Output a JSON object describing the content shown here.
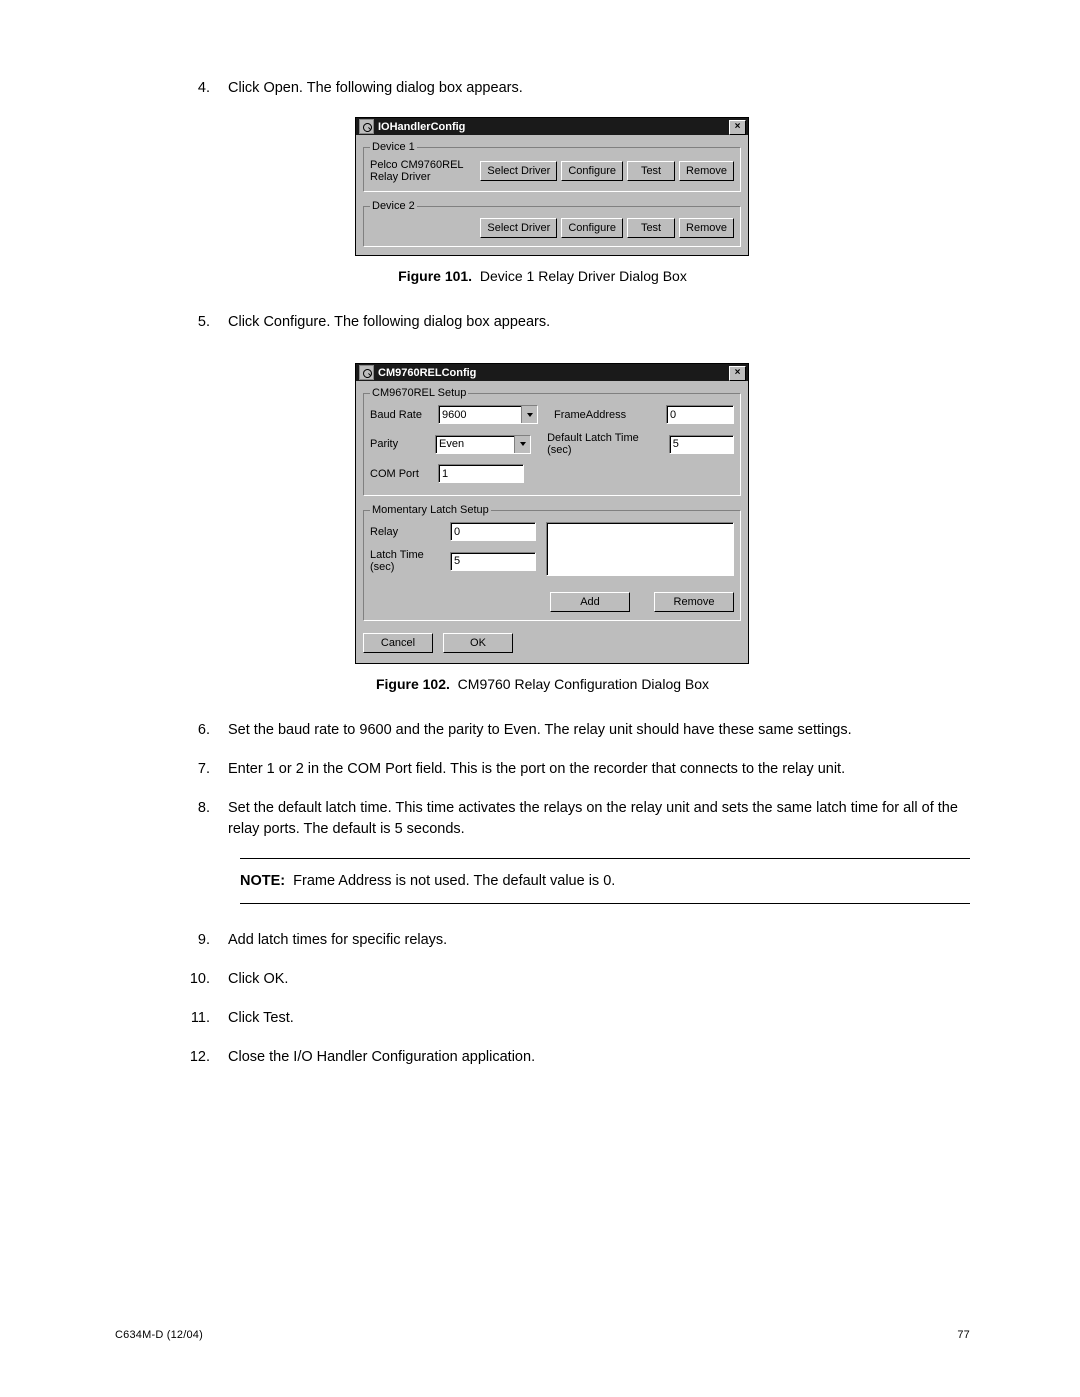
{
  "steps": {
    "s4": "Click Open. The following dialog box appears.",
    "s5": "Click Configure. The following dialog box appears.",
    "s6": "Set the baud rate to 9600 and the parity to Even. The relay unit should have these same settings.",
    "s7": "Enter 1 or 2 in the COM Port field. This is the port on the recorder that connects to the relay unit.",
    "s8": "Set the default latch time. This time activates the relays on the relay unit and sets the same latch time for all of the relay ports. The default is 5 seconds.",
    "s9": "Add latch times for specific relays.",
    "s10": "Click OK.",
    "s11": "Click Test.",
    "s12": "Close the I/O Handler Configuration application."
  },
  "fig101": {
    "label": "Figure 101.",
    "text": "Device 1 Relay Driver Dialog Box"
  },
  "fig102": {
    "label": "Figure 102.",
    "text": "CM9760 Relay Configuration Dialog Box"
  },
  "note_label": "NOTE:",
  "note_text": "Frame Address is not used. The default value is 0.",
  "dlg1": {
    "title": "IOHandlerConfig",
    "dev1_legend": "Device 1",
    "dev1_text": "Pelco CM9760REL Relay Driver",
    "dev2_legend": "Device 2",
    "btn_select": "Select Driver",
    "btn_configure": "Configure",
    "btn_test": "Test",
    "btn_remove": "Remove"
  },
  "dlg2": {
    "title": "CM9760RELConfig",
    "grp_setup": "CM9670REL Setup",
    "lbl_baud": "Baud Rate",
    "val_baud": "9600",
    "lbl_parity": "Parity",
    "val_parity": "Even",
    "lbl_com": "COM Port",
    "val_com": "1",
    "lbl_frame": "FrameAddress",
    "val_frame": "0",
    "lbl_latchdef": "Default Latch Time (sec)",
    "val_latchdef": "5",
    "grp_mom": "Momentary Latch Setup",
    "lbl_relay": "Relay",
    "val_relay": "0",
    "lbl_latch": "Latch Time (sec)",
    "val_latch": "5",
    "btn_add": "Add",
    "btn_remove": "Remove",
    "btn_cancel": "Cancel",
    "btn_ok": "OK"
  },
  "footer_left": "C634M-D (12/04)",
  "footer_right": "77"
}
